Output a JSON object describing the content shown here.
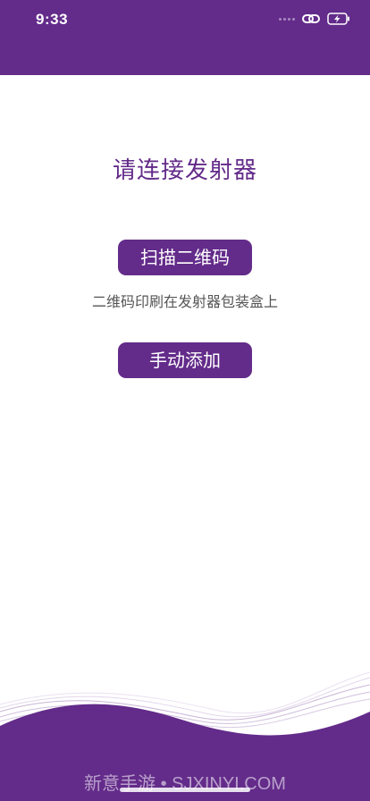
{
  "status_bar": {
    "time": "9:33",
    "icons": [
      "signal-dots",
      "link-icon",
      "battery-charging-icon"
    ]
  },
  "main": {
    "title": "请连接发射器",
    "scan_button_label": "扫描二维码",
    "hint": "二维码印刷在发射器包装盒上",
    "manual_button_label": "手动添加"
  },
  "footer": {
    "watermark": "新意手游 • SJXINYI.COM"
  },
  "colors": {
    "primary": "#632b8a",
    "background": "#ffffff",
    "hint_text": "#555555"
  }
}
